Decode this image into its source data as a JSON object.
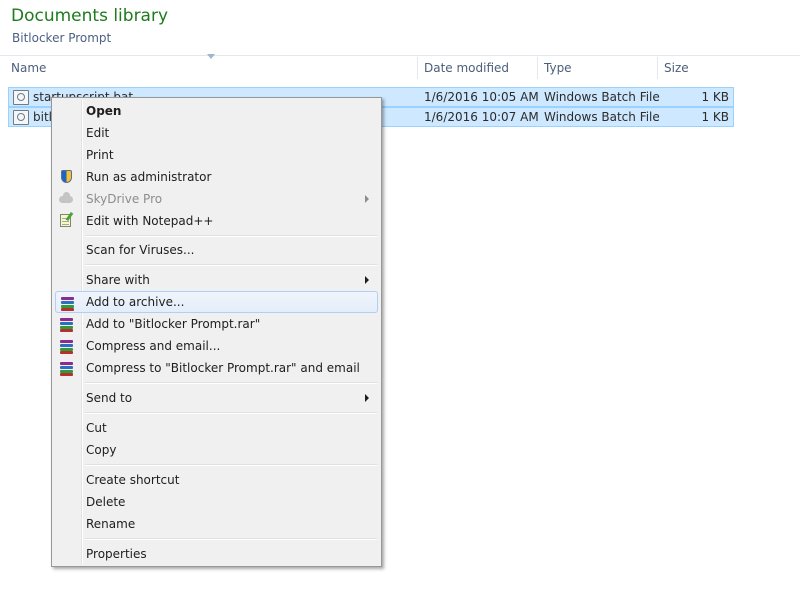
{
  "library": {
    "title": "Documents library",
    "subtitle": "Bitlocker Prompt"
  },
  "columns": {
    "name": "Name",
    "date_modified": "Date modified",
    "type": "Type",
    "size": "Size"
  },
  "files": [
    {
      "name": "startupscript.bat",
      "date": "1/6/2016 10:05 AM",
      "type": "Windows Batch File",
      "size": "1 KB",
      "selected": true
    },
    {
      "name": "bitl",
      "date": "1/6/2016 10:07 AM",
      "type": "Windows Batch File",
      "size": "1 KB",
      "selected": true
    }
  ],
  "context_menu": {
    "items": [
      {
        "label": "Open",
        "bold": true
      },
      {
        "label": "Edit"
      },
      {
        "label": "Print"
      },
      {
        "label": "Run as administrator",
        "icon": "uac-shield-icon"
      },
      {
        "label": "SkyDrive Pro",
        "icon": "cloud-icon",
        "disabled": true,
        "submenu": true
      },
      {
        "label": "Edit with Notepad++",
        "icon": "notepad-plus-plus-icon"
      },
      {
        "label": "Scan for Viruses..."
      },
      {
        "label": "Share with",
        "submenu": true
      },
      {
        "label": "Add to archive...",
        "icon": "winrar-icon",
        "highlighted": true
      },
      {
        "label": "Add to \"Bitlocker Prompt.rar\"",
        "icon": "winrar-icon"
      },
      {
        "label": "Compress and email...",
        "icon": "winrar-icon"
      },
      {
        "label": "Compress to \"Bitlocker Prompt.rar\" and email",
        "icon": "winrar-icon"
      },
      {
        "label": "Send to",
        "submenu": true
      },
      {
        "label": "Cut"
      },
      {
        "label": "Copy"
      },
      {
        "label": "Create shortcut"
      },
      {
        "label": "Delete"
      },
      {
        "label": "Rename"
      },
      {
        "label": "Properties"
      }
    ]
  },
  "colors": {
    "library_title": "#1e7b1e",
    "selection_fill": "#cde8ff",
    "selection_border": "#99d1ff",
    "menu_background": "#f0f0f0",
    "menu_highlight_border": "#aecff7"
  }
}
